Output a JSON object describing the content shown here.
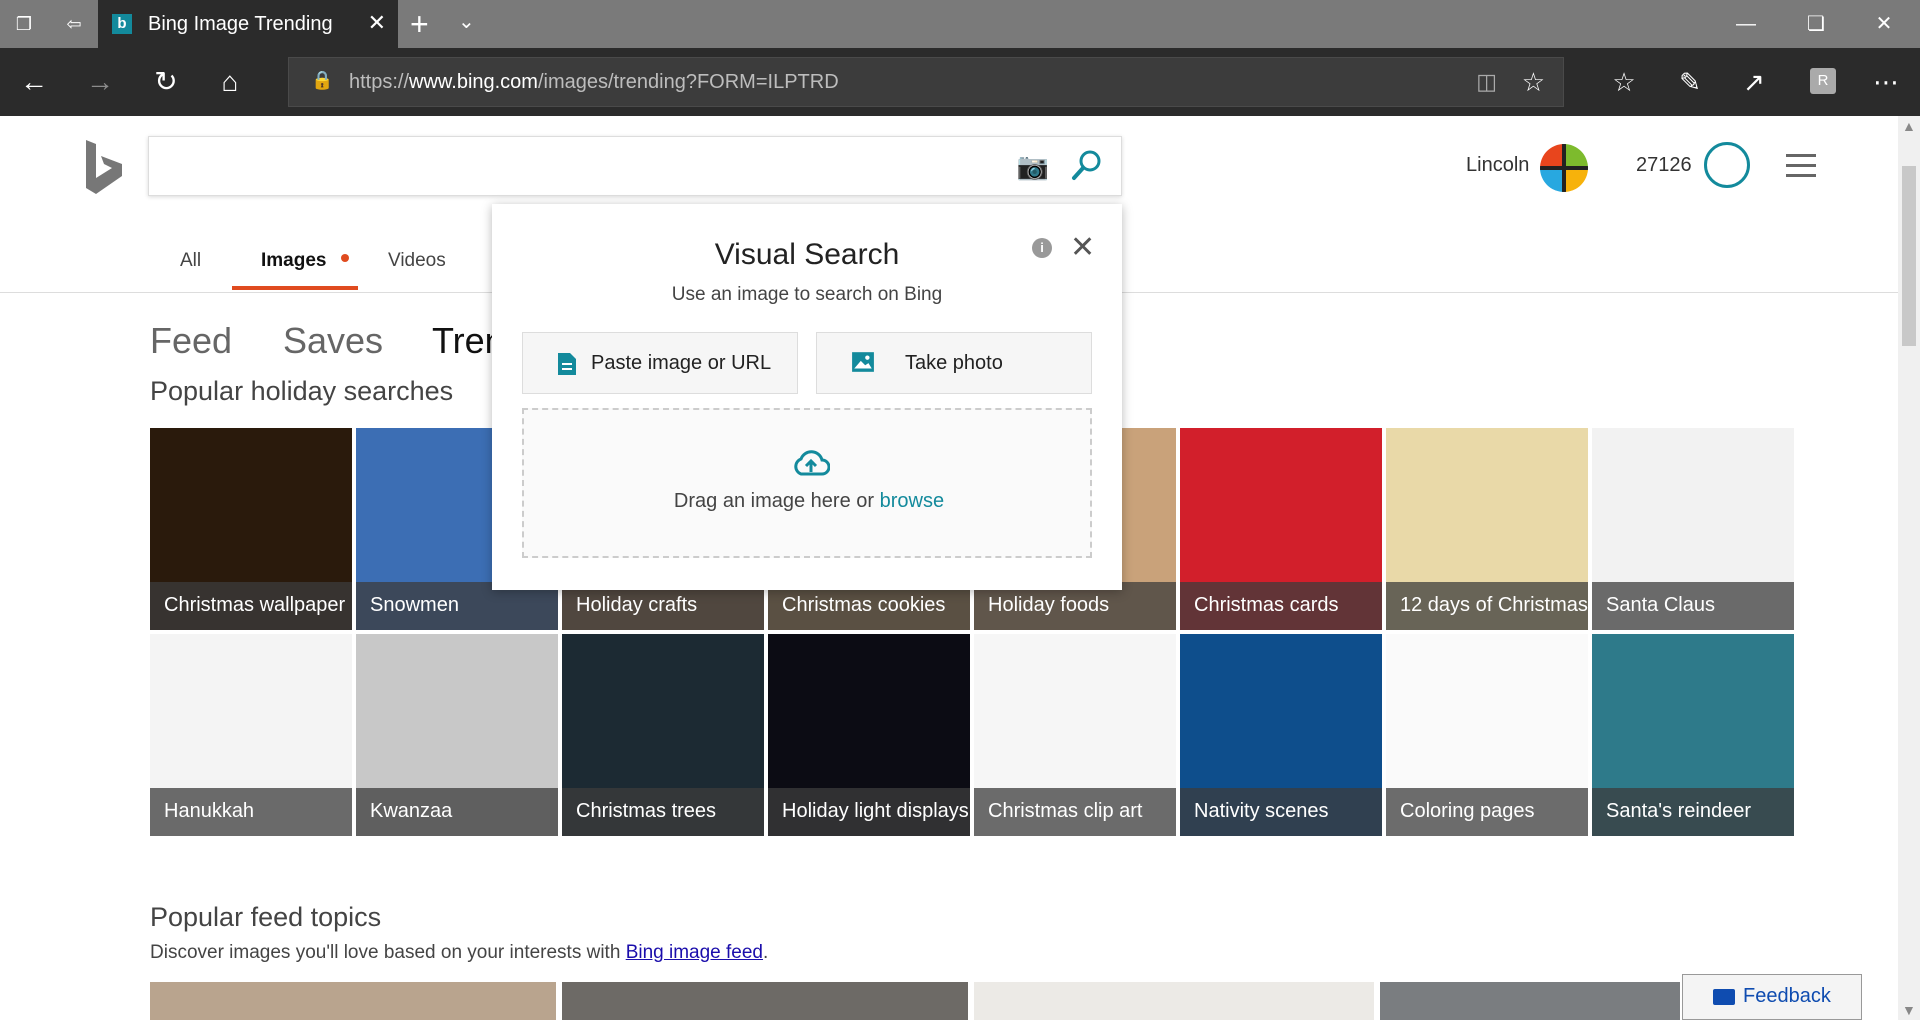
{
  "browser": {
    "tab_title": "Bing Image Trending",
    "url_scheme": "https://",
    "url_host": "www.bing.com",
    "url_path": "/images/trending?FORM=ILPTRD"
  },
  "header": {
    "search_value": "",
    "username": "Lincoln",
    "points": "27126"
  },
  "scopes": [
    "All",
    "Images",
    "Videos"
  ],
  "subnav": [
    "Feed",
    "Saves",
    "Tren"
  ],
  "sections": {
    "holiday_title": "Popular holiday searches",
    "feed_title": "Popular feed topics",
    "feed_sub_prefix": "Discover images you'll love based on your interests with ",
    "feed_sub_link": "Bing image feed",
    "feed_sub_suffix": "."
  },
  "tiles": [
    {
      "label": "Christmas wallpaper",
      "color": "#2a1a0c"
    },
    {
      "label": "Snowmen",
      "color": "#3c6eb4"
    },
    {
      "label": "Holiday crafts",
      "color": "#8c6a4a"
    },
    {
      "label": "Christmas cookies",
      "color": "#b58a5a"
    },
    {
      "label": "Holiday foods",
      "color": "#c9a27a"
    },
    {
      "label": "Christmas cards",
      "color": "#d21f2b"
    },
    {
      "label": "12 days of Christmas",
      "color": "#e9d9a8"
    },
    {
      "label": "Santa Claus",
      "color": "#f2f2f2"
    },
    {
      "label": "Hanukkah",
      "color": "#f4f4f4"
    },
    {
      "label": "Kwanzaa",
      "color": "#c8c8c8"
    },
    {
      "label": "Christmas trees",
      "color": "#1c2a33"
    },
    {
      "label": "Holiday light displays",
      "color": "#0c0c14"
    },
    {
      "label": "Christmas clip art",
      "color": "#f6f6f6"
    },
    {
      "label": "Nativity scenes",
      "color": "#0e4e8c"
    },
    {
      "label": "Coloring pages",
      "color": "#fafafa"
    },
    {
      "label": "Santa's reindeer",
      "color": "#2e7a8a"
    }
  ],
  "visual_search": {
    "title": "Visual Search",
    "subtitle": "Use an image to search on Bing",
    "paste_label": "Paste image or URL",
    "photo_label": "Take photo",
    "drop_text": "Drag an image here or ",
    "browse_label": "browse"
  },
  "feedback_label": "Feedback",
  "colors": {
    "accent": "#138a9c",
    "scope_active": "#e04b1f"
  }
}
